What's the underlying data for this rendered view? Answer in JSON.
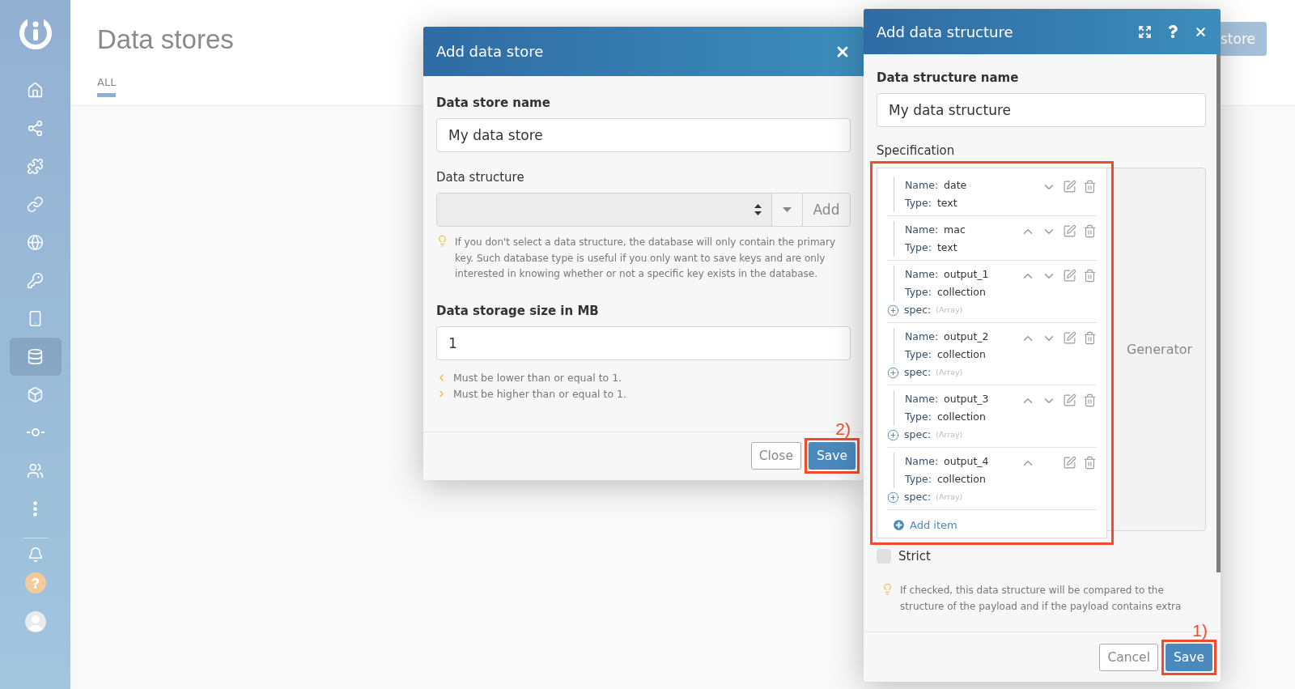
{
  "sidebar": {
    "items": [
      {
        "selected": false
      },
      {
        "selected": false
      },
      {
        "selected": false
      },
      {
        "selected": false
      },
      {
        "selected": false
      },
      {
        "selected": false
      },
      {
        "selected": false
      },
      {
        "selected": true
      },
      {
        "selected": false
      },
      {
        "selected": false
      },
      {
        "selected": false
      },
      {
        "selected": false
      }
    ]
  },
  "page": {
    "title": "Data stores",
    "tabs": [
      {
        "label": "ALL",
        "selected": true
      }
    ],
    "action_button": "store"
  },
  "data_store_dialog": {
    "title": "Add data store",
    "name_label": "Data store name",
    "name_value": "My data store",
    "structure_label": "Data structure",
    "add_button": "Add",
    "hint": "If you don't select a data structure, the database will only contain the primary key. Such database type is useful if you only want to save keys and are only interested in knowing whether or not a specific key exists in the database.",
    "size_label": "Data storage size in MB",
    "size_value": "1",
    "rules": [
      {
        "kind": "lower",
        "text": "Must be lower than or equal to 1."
      },
      {
        "kind": "higher",
        "text": "Must be higher than or equal to 1."
      }
    ],
    "close_button": "Close",
    "save_button": "Save",
    "annotation": "2)"
  },
  "data_structure_dialog": {
    "title": "Add data structure",
    "name_label": "Data structure name",
    "name_value": "My data structure",
    "spec_label": "Specification",
    "items": [
      {
        "name_label": "Name:",
        "name": "date",
        "type_label": "Type:",
        "type": "text",
        "can_move_up": false,
        "can_move_down": true
      },
      {
        "name_label": "Name:",
        "name": "mac",
        "type_label": "Type:",
        "type": "text",
        "can_move_up": true,
        "can_move_down": true
      },
      {
        "name_label": "Name:",
        "name": "output_1",
        "type_label": "Type:",
        "type": "collection",
        "spec_label": "spec:",
        "spec_type": "(Array)",
        "can_move_up": true,
        "can_move_down": true
      },
      {
        "name_label": "Name:",
        "name": "output_2",
        "type_label": "Type:",
        "type": "collection",
        "spec_label": "spec:",
        "spec_type": "(Array)",
        "can_move_up": true,
        "can_move_down": true
      },
      {
        "name_label": "Name:",
        "name": "output_3",
        "type_label": "Type:",
        "type": "collection",
        "spec_label": "spec:",
        "spec_type": "(Array)",
        "can_move_up": true,
        "can_move_down": true
      },
      {
        "name_label": "Name:",
        "name": "output_4",
        "type_label": "Type:",
        "type": "collection",
        "spec_label": "spec:",
        "spec_type": "(Array)",
        "can_move_up": true,
        "can_move_down": false
      }
    ],
    "add_item": "Add item",
    "generator": "Generator",
    "strict": {
      "label": "Strict",
      "checked": false
    },
    "hint": "If checked, this data structure will be compared to the structure of the payload and if the payload contains extra",
    "cancel_button": "Cancel",
    "save_button": "Save",
    "annotation": "1)"
  }
}
